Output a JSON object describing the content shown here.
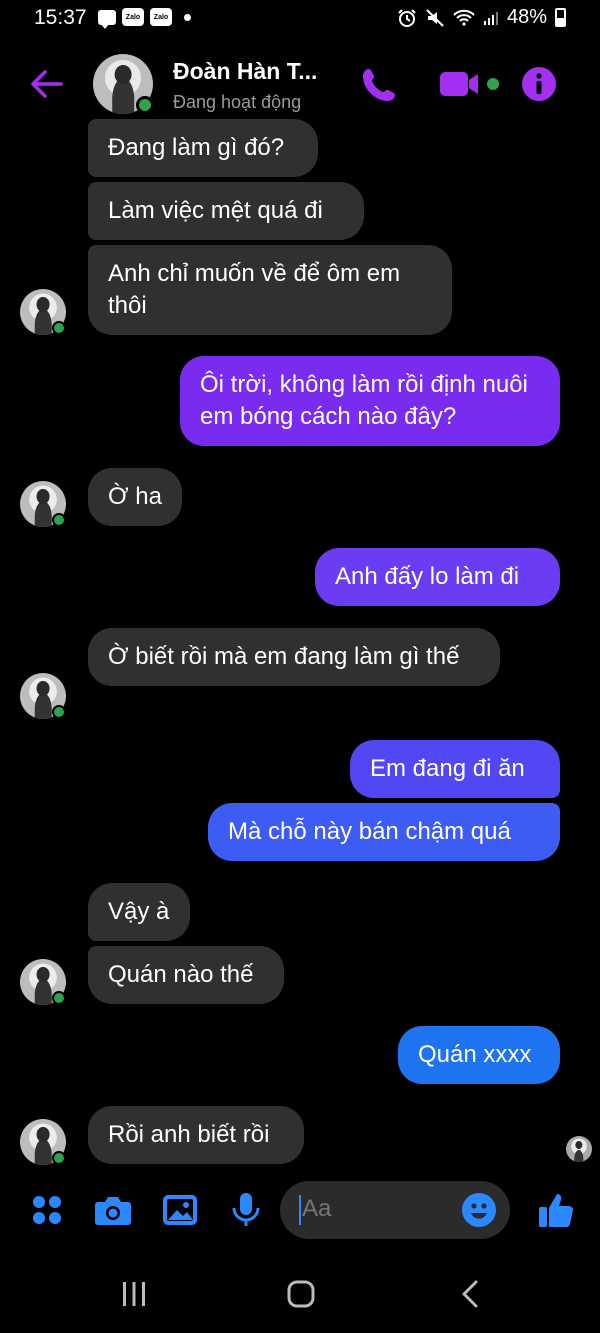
{
  "status_bar": {
    "time": "15:37",
    "zalo_1": "Zalo",
    "zalo_2": "Zalo",
    "battery": "48%"
  },
  "header": {
    "contact_name": "Đoàn Hàn T...",
    "contact_status": "Đang hoạt động",
    "accent_color": "#a32ff0",
    "icons": [
      "back-arrow-icon",
      "phone-icon",
      "video-camera-icon",
      "info-icon"
    ]
  },
  "messages": [
    {
      "dir": "in",
      "text": "Đang làm gì đó?"
    },
    {
      "dir": "in",
      "text": "Làm việc mệt quá đi"
    },
    {
      "dir": "in",
      "text": "Anh chỉ muốn về để ôm em thôi"
    },
    {
      "dir": "out",
      "text": "Ôi trời, không làm rồi định nuôi em bóng cách nào đây?"
    },
    {
      "dir": "in",
      "text": "Ờ ha"
    },
    {
      "dir": "out",
      "text": "Anh đấy lo làm đi"
    },
    {
      "dir": "in",
      "text": "Ờ biết rồi mà em đang làm gì thế"
    },
    {
      "dir": "out",
      "text": "Em đang đi ăn"
    },
    {
      "dir": "out",
      "text": "Mà chỗ này bán chậm quá"
    },
    {
      "dir": "in",
      "text": "Vậy à"
    },
    {
      "dir": "in",
      "text": "Quán nào thế"
    },
    {
      "dir": "out",
      "text": "Quán xxxx"
    },
    {
      "dir": "in",
      "text": "Rồi anh biết rồi"
    }
  ],
  "composer": {
    "placeholder": "Aa",
    "icon_color": "#2d88ff",
    "icons": [
      "menu-grid-icon",
      "camera-icon",
      "gallery-icon",
      "microphone-icon",
      "emoji-icon",
      "thumbs-up-icon"
    ]
  },
  "navbar": {
    "icons": [
      "recent-apps-icon",
      "home-icon",
      "back-icon"
    ]
  }
}
